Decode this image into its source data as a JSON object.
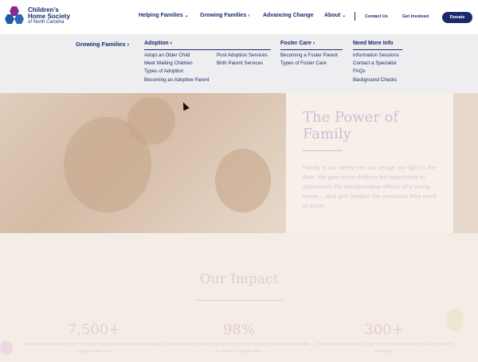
{
  "logo": {
    "line1": "Children's",
    "line2": "Home Society",
    "line3": "of North Carolina"
  },
  "nav": {
    "helping": "Helping Families",
    "growing": "Growing Families",
    "advancing": "Advancing Change",
    "about": "About",
    "contact": "Contact Us",
    "involved": "Get Involved",
    "donate": "Donate"
  },
  "mega": {
    "heading": "Growing Families",
    "adoption": {
      "title": "Adoption",
      "col1": [
        "Adopt an Older Child",
        "Meet Waiting Children",
        "Types of Adoption",
        "Becoming an Adoptive Parent"
      ],
      "col2": [
        "Post Adoption Services",
        "Birth Parent Services"
      ]
    },
    "foster": {
      "title": "Foster Care",
      "items": [
        "Becoming a Foster Parent",
        "Types of Foster Care"
      ]
    },
    "info": {
      "title": "Need More Info",
      "items": [
        "Information Sessions",
        "Contact a Specialist",
        "FAQs",
        "Background Checks"
      ]
    }
  },
  "hero": {
    "title": "The Power of Family",
    "body": "Family is our safety net, our refuge, our light in the dark. We give more children the opportunity to experience the transformative effects of a loving home ... and give families the resources they need to thrive."
  },
  "impact": {
    "title": "Our Impact",
    "stats": [
      {
        "num": "7,500+",
        "desc": "parents have benefited from our early childhood parent education support programs last year."
      },
      {
        "num": "98%",
        "desc": "of families at imminent risk of their children entering foster care were able to remain together after"
      },
      {
        "num": "300+",
        "desc": "children exit foster care to their forever families through CHS programs each year."
      }
    ]
  },
  "colors": {
    "navy": "#1a2a6b",
    "bg": "#f4ede6",
    "menu": "#eeeef0"
  }
}
